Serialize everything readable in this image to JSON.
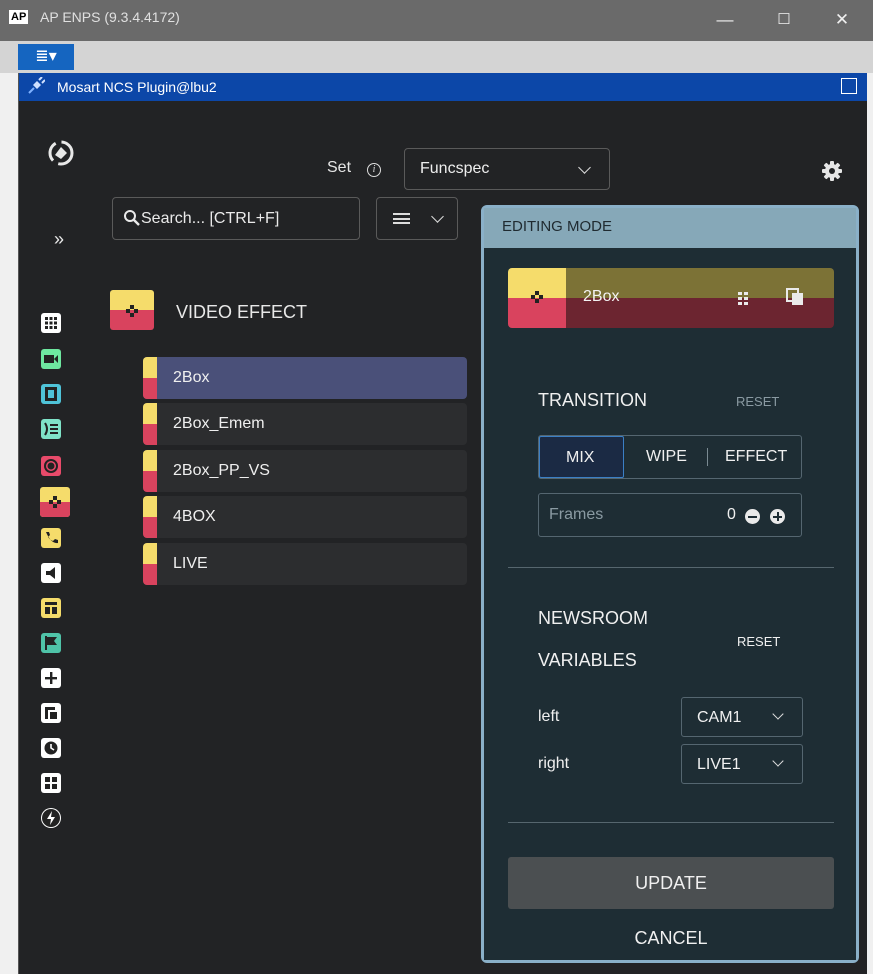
{
  "window": {
    "app_logo": "AP",
    "title": "AP ENPS (9.3.4.4172)",
    "controls": {
      "minimize": "—",
      "maximize": "☐",
      "close": "✕"
    }
  },
  "menubar": {
    "menu_glyph": "≣▾"
  },
  "plugin": {
    "title": "Mosart NCS Plugin@lbu2",
    "set": {
      "label": "Set",
      "info_glyph": "i",
      "value": "Funcspec"
    },
    "expand_glyph": "»",
    "search": {
      "placeholder": "Search... [CTRL+F]"
    },
    "sidebar_icons": [
      {
        "name": "grid-icon",
        "color": "#ffffff"
      },
      {
        "name": "camera-icon",
        "color": "#6ee7a0"
      },
      {
        "name": "film-icon",
        "color": "#4fc3d8"
      },
      {
        "name": "voiceover-icon",
        "color": "#7fe3c8"
      },
      {
        "name": "record-icon",
        "color": "#e84a6a"
      },
      {
        "name": "video-effect-icon",
        "color": "#f5dc6b"
      },
      {
        "name": "phone-icon",
        "color": "#f5dc6b"
      },
      {
        "name": "audio-icon",
        "color": "#ffffff"
      },
      {
        "name": "layout-icon",
        "color": "#f5dc6b"
      },
      {
        "name": "flag-icon",
        "color": "#4fc3a8"
      },
      {
        "name": "plus-icon",
        "color": "#ffffff"
      },
      {
        "name": "graphics-icon",
        "color": "#ffffff"
      },
      {
        "name": "clock-icon",
        "color": "#ffffff"
      },
      {
        "name": "table-icon",
        "color": "#ffffff"
      },
      {
        "name": "lightning-icon",
        "color": "#ffffff"
      }
    ],
    "category": {
      "label": "VIDEO EFFECT"
    },
    "items": [
      {
        "label": "2Box",
        "selected": true
      },
      {
        "label": "2Box_Emem",
        "selected": false
      },
      {
        "label": "2Box_PP_VS",
        "selected": false
      },
      {
        "label": "4BOX",
        "selected": false
      },
      {
        "label": "LIVE",
        "selected": false
      }
    ],
    "editing": {
      "header": "EDITING MODE",
      "selected_item": "2Box",
      "transition": {
        "title": "TRANSITION",
        "reset": "RESET",
        "options": [
          "MIX",
          "WIPE",
          "EFFECT"
        ],
        "active": "MIX",
        "frames_label": "Frames",
        "frames_value": "0"
      },
      "newsroom": {
        "title_line1": "NEWSROOM",
        "title_line2": "VARIABLES",
        "reset": "RESET",
        "variables": [
          {
            "label": "left",
            "value": "CAM1"
          },
          {
            "label": "right",
            "value": "LIVE1"
          }
        ]
      },
      "update_label": "UPDATE",
      "cancel_label": "CANCEL"
    }
  },
  "colors": {
    "accent_blue": "#0c47a8",
    "effect_yellow": "#f5dc6b",
    "effect_red": "#d9435e",
    "selected_row": "#4a5079",
    "panel_header": "#86a8b8"
  }
}
